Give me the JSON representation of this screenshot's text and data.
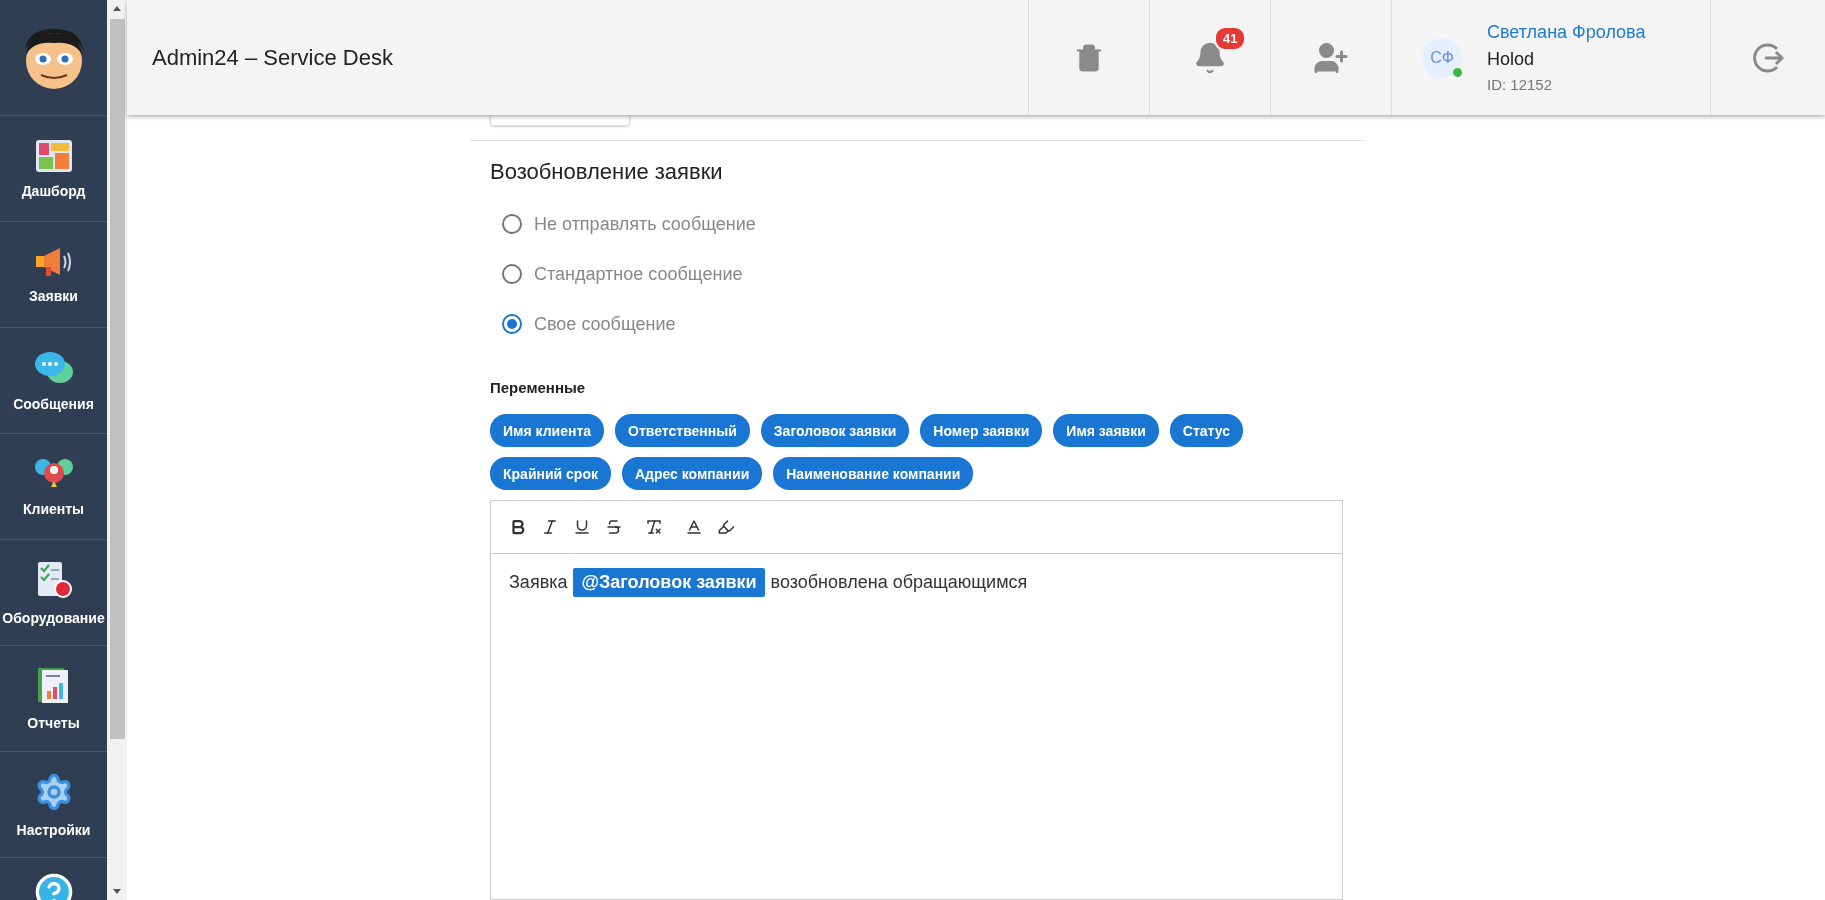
{
  "sidebar": {
    "items": [
      {
        "kind": "dashboard",
        "label": "Дашборд"
      },
      {
        "kind": "tickets",
        "label": "Заявки"
      },
      {
        "kind": "messages",
        "label": "Сообщения"
      },
      {
        "kind": "clients",
        "label": "Клиенты"
      },
      {
        "kind": "equipment",
        "label": "Оборудование"
      },
      {
        "kind": "reports",
        "label": "Отчеты"
      },
      {
        "kind": "settings",
        "label": "Настройки"
      },
      {
        "kind": "help"
      }
    ]
  },
  "header": {
    "title": "Admin24 – Service Desk",
    "notifications_badge": "41",
    "user": {
      "initials": "СФ",
      "online": true,
      "name": "Светлана Фролова",
      "company": "Holod",
      "id": "ID: 12152"
    }
  },
  "section": {
    "title": "Возобновление заявки",
    "options": [
      {
        "label": "Не отправлять сообщение",
        "selected": false
      },
      {
        "label": "Стандартное сообщение",
        "selected": false
      },
      {
        "label": "Свое сообщение",
        "selected": true
      }
    ]
  },
  "variables": {
    "title": "Переменные",
    "chips": [
      "Имя клиента",
      "Ответственный",
      "Заголовок заявки",
      "Номер заявки",
      "Имя заявки",
      "Статус",
      "Крайний срок",
      "Адрес компании",
      "Наименование компании"
    ]
  },
  "editor": {
    "content": [
      {
        "kind": "text",
        "text": "Заявка"
      },
      {
        "kind": "tag",
        "text": "@Заголовок заявки"
      },
      {
        "kind": "text",
        "text": "возобновлена обращающимся"
      }
    ]
  }
}
